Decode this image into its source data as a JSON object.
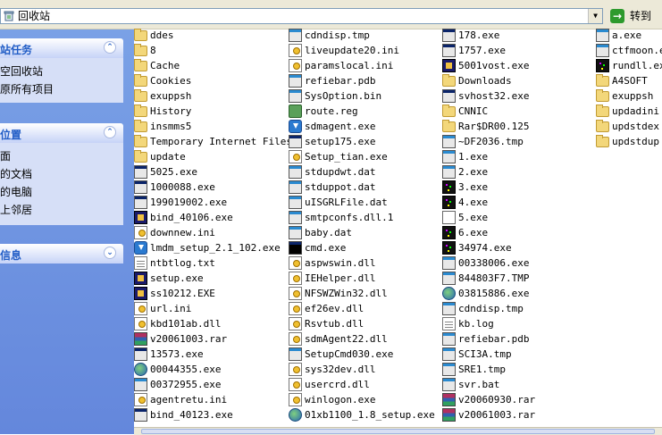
{
  "address": {
    "path": "回收站",
    "go_label": "转到"
  },
  "taskpane": {
    "panels": [
      {
        "title": "站任务",
        "chevron": "⌃",
        "items": [
          "空回收站",
          "原所有项目"
        ]
      },
      {
        "title": "位置",
        "chevron": "⌃",
        "items": [
          "面",
          "的文档",
          "的电脑",
          "上邻居"
        ]
      },
      {
        "title": "信息",
        "chevron": "⌄",
        "items": []
      }
    ]
  },
  "files": [
    [
      {
        "name": "ddes",
        "icon": "folder"
      },
      {
        "name": "8",
        "icon": "folder"
      },
      {
        "name": "Cache",
        "icon": "folder"
      },
      {
        "name": "Cookies",
        "icon": "folder"
      },
      {
        "name": "exuppsh",
        "icon": "folder"
      },
      {
        "name": "History",
        "icon": "folder"
      },
      {
        "name": "insmms5",
        "icon": "folder"
      },
      {
        "name": "Temporary Internet Files",
        "icon": "folder"
      },
      {
        "name": "update",
        "icon": "folder"
      },
      {
        "name": "5025.exe",
        "icon": "exe"
      },
      {
        "name": "1000088.exe",
        "icon": "exe"
      },
      {
        "name": "199019002.exe",
        "icon": "exe"
      },
      {
        "name": "bind_40106.exe",
        "icon": "app"
      },
      {
        "name": "downnew.ini",
        "icon": "ini"
      },
      {
        "name": "lmdm_setup_2.1_102.exe",
        "icon": "dl"
      },
      {
        "name": "ntbtlog.txt",
        "icon": "doc"
      },
      {
        "name": "setup.exe",
        "icon": "app"
      },
      {
        "name": "ss10212.EXE",
        "icon": "app"
      },
      {
        "name": "url.ini",
        "icon": "ini"
      },
      {
        "name": "kbd101ab.dll",
        "icon": "ini"
      },
      {
        "name": "v20061003.rar",
        "icon": "rar"
      },
      {
        "name": "13573.exe",
        "icon": "exe"
      },
      {
        "name": "00044355.exe",
        "icon": "globe"
      },
      {
        "name": "00372955.exe",
        "icon": "win"
      },
      {
        "name": "agentretu.ini",
        "icon": "ini"
      },
      {
        "name": "bind_40123.exe",
        "icon": "exe"
      }
    ],
    [
      {
        "name": "cdndisp.tmp",
        "icon": "win"
      },
      {
        "name": "liveupdate20.ini",
        "icon": "ini"
      },
      {
        "name": "paramslocal.ini",
        "icon": "ini"
      },
      {
        "name": "refiebar.pdb",
        "icon": "win"
      },
      {
        "name": "SysOption.bin",
        "icon": "win"
      },
      {
        "name": "route.reg",
        "icon": "reg"
      },
      {
        "name": "sdmagent.exe",
        "icon": "dl"
      },
      {
        "name": "setup175.exe",
        "icon": "exe"
      },
      {
        "name": "Setup_tian.exe",
        "icon": "ini"
      },
      {
        "name": "stdupdwt.dat",
        "icon": "win"
      },
      {
        "name": "stduppot.dat",
        "icon": "win"
      },
      {
        "name": "uISGRLFile.dat",
        "icon": "win"
      },
      {
        "name": "smtpconfs.dll.1",
        "icon": "win"
      },
      {
        "name": "baby.dat",
        "icon": "win"
      },
      {
        "name": "cmd.exe",
        "icon": "cmd"
      },
      {
        "name": "aspwswin.dll",
        "icon": "ini"
      },
      {
        "name": "IEHelper.dll",
        "icon": "ini"
      },
      {
        "name": "NFSWZWin32.dll",
        "icon": "ini"
      },
      {
        "name": "ef26ev.dll",
        "icon": "ini"
      },
      {
        "name": "Rsvtub.dll",
        "icon": "ini"
      },
      {
        "name": "sdmAgent22.dll",
        "icon": "ini"
      },
      {
        "name": "SetupCmd030.exe",
        "icon": "win"
      },
      {
        "name": "sys32dev.dll",
        "icon": "ini"
      },
      {
        "name": "usercrd.dll",
        "icon": "ini"
      },
      {
        "name": "winlogon.exe",
        "icon": "ini"
      },
      {
        "name": "01xb1100_1.8_setup.exe",
        "icon": "globe"
      }
    ],
    [
      {
        "name": "178.exe",
        "icon": "exe"
      },
      {
        "name": "1757.exe",
        "icon": "exe"
      },
      {
        "name": "5001vost.exe",
        "icon": "app"
      },
      {
        "name": "Downloads",
        "icon": "folder"
      },
      {
        "name": "svhost32.exe",
        "icon": "exe"
      },
      {
        "name": "CNNIC",
        "icon": "folder"
      },
      {
        "name": "Rar$DR00.125",
        "icon": "folder"
      },
      {
        "name": "~DF2036.tmp",
        "icon": "win"
      },
      {
        "name": "1.exe",
        "icon": "win"
      },
      {
        "name": "2.exe",
        "icon": "win"
      },
      {
        "name": "3.exe",
        "icon": "dark"
      },
      {
        "name": "4.exe",
        "icon": "dark"
      },
      {
        "name": "5.exe",
        "icon": "blank"
      },
      {
        "name": "6.exe",
        "icon": "dark"
      },
      {
        "name": "34974.exe",
        "icon": "dark"
      },
      {
        "name": "00338006.exe",
        "icon": "win"
      },
      {
        "name": "844803F7.TMP",
        "icon": "win"
      },
      {
        "name": "03815886.exe",
        "icon": "globe"
      },
      {
        "name": "cdndisp.tmp",
        "icon": "win"
      },
      {
        "name": "kb.log",
        "icon": "doc"
      },
      {
        "name": "refiebar.pdb",
        "icon": "win"
      },
      {
        "name": "SCI3A.tmp",
        "icon": "win"
      },
      {
        "name": "SRE1.tmp",
        "icon": "win"
      },
      {
        "name": "svr.bat",
        "icon": "win"
      },
      {
        "name": "v20060930.rar",
        "icon": "rar"
      },
      {
        "name": "v20061003.rar",
        "icon": "rar"
      }
    ],
    [
      {
        "name": "a.exe",
        "icon": "win"
      },
      {
        "name": "ctfmoon.ex",
        "icon": "win"
      },
      {
        "name": "rundll.ex",
        "icon": "dark"
      },
      {
        "name": "A4SOFT",
        "icon": "folder"
      },
      {
        "name": "exuppsh",
        "icon": "folder"
      },
      {
        "name": "updadini",
        "icon": "folder"
      },
      {
        "name": "updstdex",
        "icon": "folder"
      },
      {
        "name": "updstdup",
        "icon": "folder"
      }
    ]
  ]
}
